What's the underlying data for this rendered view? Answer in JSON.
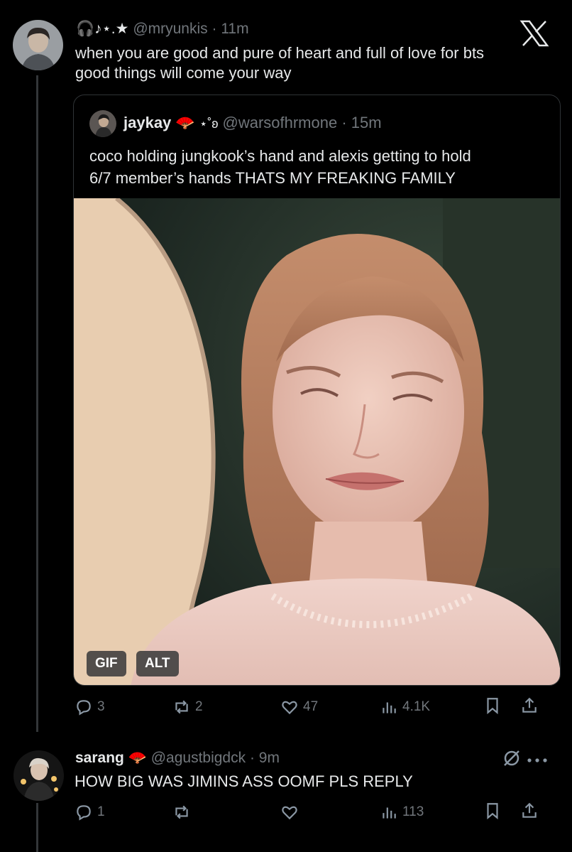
{
  "post": {
    "emoji_prefix": "🎧♪⋆.★",
    "handle": "@mryunkis",
    "time": "11m",
    "text_line1": "when you are good and pure of heart and full of love for bts",
    "text_line2": "good things will come your way",
    "quote": {
      "name": "jaykay",
      "name_emoji": "🪭",
      "decoration": "⋆˚ʚ",
      "handle": "@warsofhrmone",
      "time": "15m",
      "text_line1": "coco holding jungkook’s hand and alexis getting to hold",
      "text_line2": "6/7 member’s hands THATS MY FREAKING FAMILY",
      "badges": [
        "GIF",
        "ALT"
      ]
    },
    "actions": {
      "replies": "3",
      "reposts": "2",
      "likes": "47",
      "views": "4.1K"
    }
  },
  "reply": {
    "name": "sarang",
    "name_emoji": "🪭",
    "handle": "@agustbigdck",
    "time": "9m",
    "text": "HOW BIG WAS JIMINS ASS OOMF PLS REPLY",
    "actions": {
      "replies": "1",
      "views": "113"
    }
  },
  "colors": {
    "background": "#000000",
    "text": "#e7e9ea",
    "secondary": "#71767b",
    "border": "#2f3336"
  }
}
